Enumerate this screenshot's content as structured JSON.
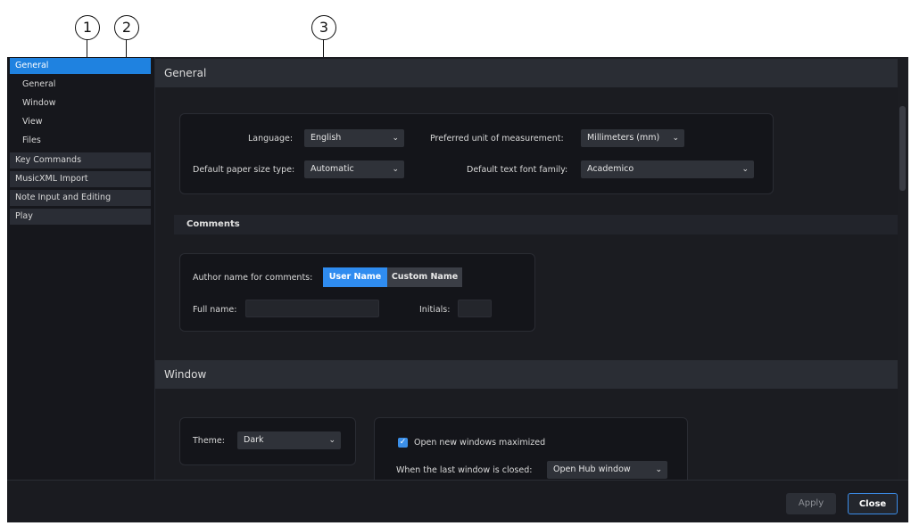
{
  "callouts": [
    "1",
    "2",
    "3"
  ],
  "sidebar": {
    "categories": [
      {
        "label": "General",
        "selected": true,
        "children": [
          "General",
          "Window",
          "View",
          "Files"
        ]
      },
      {
        "label": "Key Commands"
      },
      {
        "label": "MusicXML Import"
      },
      {
        "label": "Note Input and Editing"
      },
      {
        "label": "Play"
      }
    ]
  },
  "general": {
    "header": "General",
    "language": {
      "label": "Language:",
      "value": "English"
    },
    "paper": {
      "label": "Default paper size type:",
      "value": "Automatic"
    },
    "unit": {
      "label": "Preferred unit of measurement:",
      "value": "Millimeters (mm)"
    },
    "font": {
      "label": "Default text font family:",
      "value": "Academico"
    },
    "comments": {
      "header": "Comments",
      "author_label": "Author name for comments:",
      "options": [
        "User Name",
        "Custom Name"
      ],
      "selected": "User Name",
      "full_name_label": "Full name:",
      "full_name_value": "",
      "initials_label": "Initials:",
      "initials_value": ""
    }
  },
  "window": {
    "header": "Window",
    "theme": {
      "label": "Theme:",
      "value": "Dark"
    },
    "maximized": {
      "label": "Open new windows maximized",
      "checked": true
    },
    "last_closed": {
      "label": "When the last window is closed:",
      "value": "Open Hub window"
    }
  },
  "footer": {
    "apply": "Apply",
    "close": "Close"
  },
  "icons": {
    "dropdown": "chevron-down-icon",
    "check": "checkmark-icon"
  },
  "colors": {
    "accent": "#1f82e0",
    "background": "#17181d",
    "panel": "#14151a"
  }
}
